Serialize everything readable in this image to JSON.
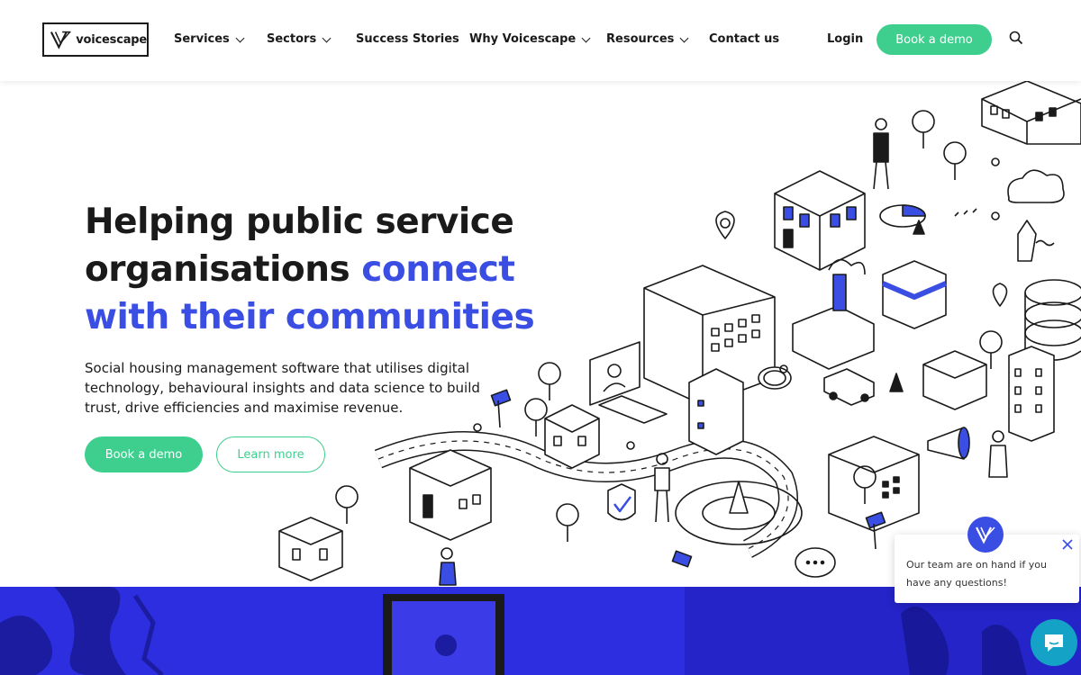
{
  "brand": {
    "name": "voicescape",
    "accent": "#3a4ee3",
    "green": "#3ecf8e",
    "band": "#2d2ee0"
  },
  "nav": {
    "items": [
      {
        "label": "Services",
        "has_dropdown": true
      },
      {
        "label": "Sectors",
        "has_dropdown": true
      },
      {
        "label": "Success Stories",
        "has_dropdown": false
      },
      {
        "label": "Why Voicescape",
        "has_dropdown": true
      },
      {
        "label": "Resources",
        "has_dropdown": true
      },
      {
        "label": "Contact us",
        "has_dropdown": false
      }
    ],
    "login": "Login",
    "cta": "Book a demo",
    "search_icon": "search-icon"
  },
  "hero": {
    "title_line1": "Helping public service",
    "title_line2_plain": "organisations ",
    "title_line2_accent": "connect",
    "title_line3_accent": "with their communities",
    "subtitle": "Social housing management software that utilises digital technology, behavioural insights and data science to build trust, drive efficiencies and maximise revenue.",
    "primary_button": "Book a demo",
    "secondary_button": "Learn more"
  },
  "chat": {
    "message": "Our team are on hand if you have any questions!",
    "close_icon": "close-icon",
    "launcher_icon": "chat-bubble-icon"
  }
}
